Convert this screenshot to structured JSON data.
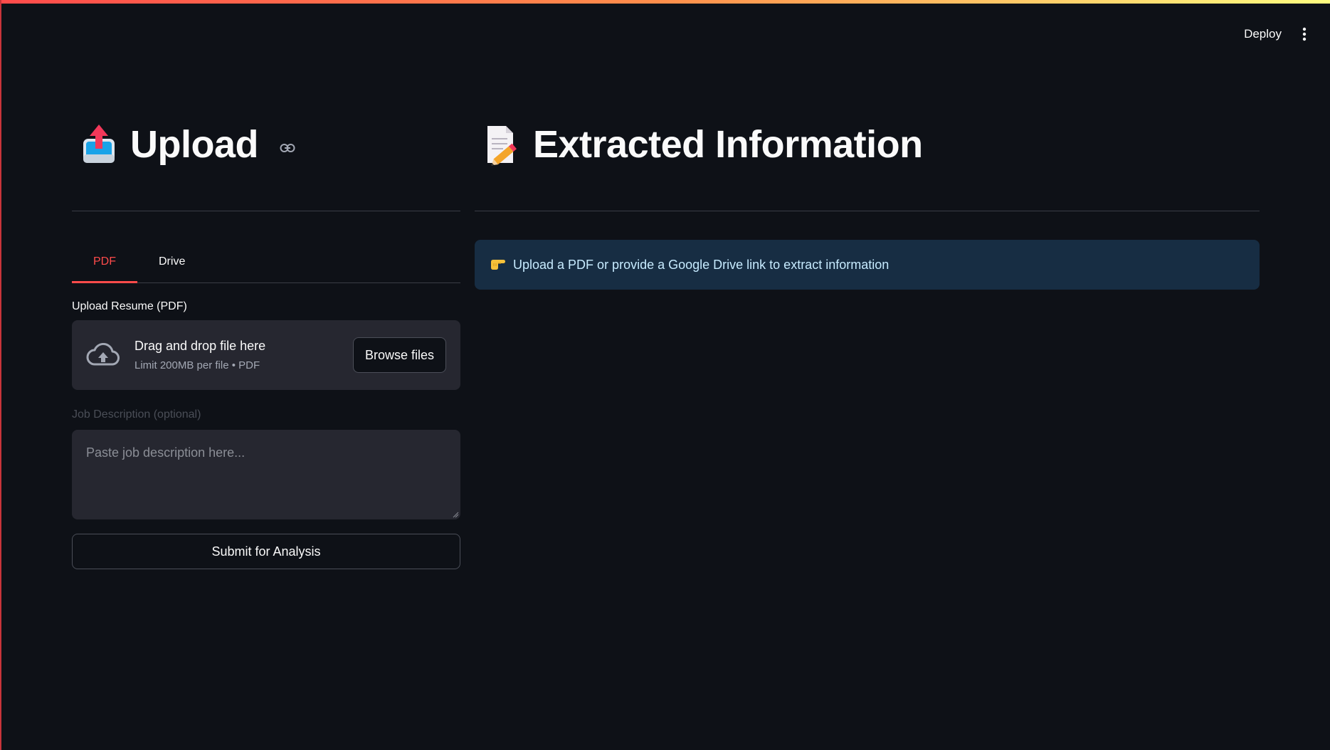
{
  "header": {
    "deploy_label": "Deploy",
    "menu_icon": "vertical-dots-icon"
  },
  "left": {
    "emoji_icon": "outbox-tray-icon",
    "title": "Upload",
    "anchor_icon": "link-icon",
    "tabs": [
      {
        "label": "PDF",
        "active": true
      },
      {
        "label": "Drive",
        "active": false
      }
    ],
    "upload_label": "Upload Resume (PDF)",
    "dropzone": {
      "icon": "cloud-upload-icon",
      "title": "Drag and drop file here",
      "subtitle": "Limit 200MB per file • PDF",
      "browse_label": "Browse files"
    },
    "job_label": "Job Description (optional)",
    "job_placeholder": "Paste job description here...",
    "submit_label": "Submit for Analysis"
  },
  "right": {
    "emoji_icon": "memo-icon",
    "title": "Extracted Information",
    "info": {
      "icon": "backhand-pointing-right-icon",
      "text": "Upload a PDF or provide a Google Drive link to extract information"
    }
  },
  "colors": {
    "background": "#0e1117",
    "accent": "#ff4b4b",
    "info_bg": "#172d43",
    "info_text": "#c7ebff",
    "input_bg": "#262730"
  }
}
